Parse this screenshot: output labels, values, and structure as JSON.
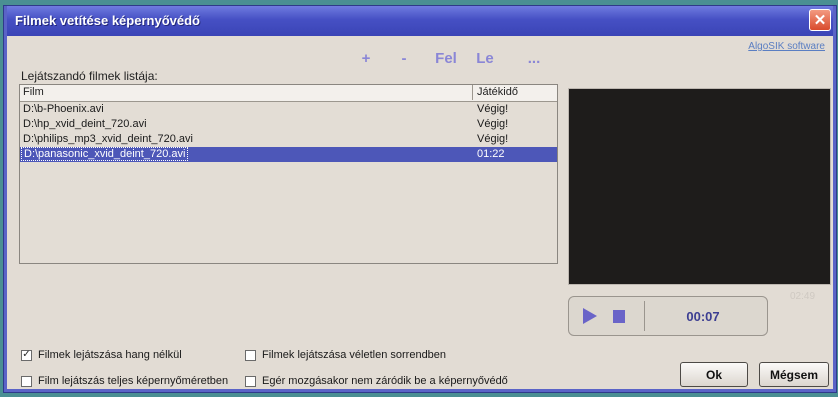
{
  "window": {
    "title": "Filmek vetítése képernyővédő",
    "close_glyph": "✕"
  },
  "toolbar": {
    "add_label": "+",
    "remove_label": "-",
    "up_label": "Fel",
    "down_label": "Le",
    "more_label": "..."
  },
  "brand_link": "AlgoSIK software",
  "list": {
    "label": "Lejátszandó filmek listája:",
    "columns": [
      "Film",
      "Játékidő"
    ],
    "rows": [
      {
        "name": "D:\\b-Phoenix.avi",
        "time": "Végig!"
      },
      {
        "name": "D:\\hp_xvid_deint_720.avi",
        "time": "Végig!"
      },
      {
        "name": "D:\\philips_mp3_xvid_deint_720.avi",
        "time": "Végig!"
      },
      {
        "name": "D:\\panasonic_xvid_deint_720.avi",
        "time": "01:22"
      }
    ],
    "selected_index": 3
  },
  "preview": {
    "duration": "02:49",
    "current_time": "00:07"
  },
  "icons": {
    "play": "play-icon",
    "stop": "stop-icon",
    "close": "close-icon"
  },
  "options": {
    "mute": {
      "label": "Filmek lejátszása hang nélkül",
      "checked": true
    },
    "shuffle": {
      "label": "Filmek lejátszása véletlen sorrendben",
      "checked": false
    },
    "fullscreen": {
      "label": "Film lejátszás teljes képernyőméretben",
      "checked": false
    },
    "mouse_no_close": {
      "label": "Egér mozgásakor nem záródik be a képernyővédő",
      "checked": false
    }
  },
  "buttons": {
    "ok_label": "Ok",
    "cancel_label": "Mégsem"
  },
  "colors": {
    "titlebar": "#4650c4",
    "selection": "#4d57b8",
    "accent": "#8a86d6"
  }
}
